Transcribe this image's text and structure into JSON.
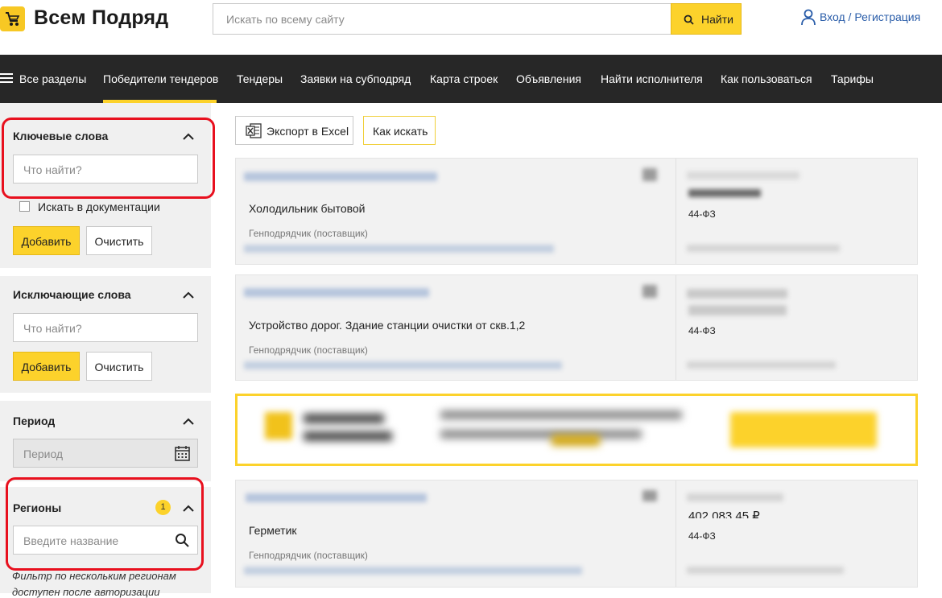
{
  "header": {
    "logo_text": "Всем Подряд",
    "search_placeholder": "Искать по всему сайту",
    "search_button": "Найти",
    "login_link": "Вход / Регистрация"
  },
  "nav": {
    "items": [
      {
        "label": "Все разделы"
      },
      {
        "label": "Победители тендеров"
      },
      {
        "label": "Тендеры"
      },
      {
        "label": "Заявки на субподряд"
      },
      {
        "label": "Карта строек"
      },
      {
        "label": "Объявления"
      },
      {
        "label": "Найти исполнителя"
      },
      {
        "label": "Как пользоваться"
      },
      {
        "label": "Тарифы"
      }
    ],
    "active_index": 1
  },
  "filters": {
    "keywords": {
      "title": "Ключевые слова",
      "placeholder": "Что найти?",
      "checkbox_label": "Искать в документации",
      "add_button": "Добавить",
      "clear_button": "Очистить"
    },
    "exclude": {
      "title": "Исключающие слова",
      "placeholder": "Что найти?",
      "add_button": "Добавить",
      "clear_button": "Очистить"
    },
    "period": {
      "title": "Период",
      "placeholder": "Период"
    },
    "regions": {
      "title": "Регионы",
      "badge": "1",
      "placeholder": "Введите название",
      "note_line1": "Фильтр по нескольким регионам",
      "note_line2": "доступен после авторизации"
    }
  },
  "toolbar": {
    "export_button": "Экспорт в Excel",
    "how_to_button": "Как искать"
  },
  "results": [
    {
      "title": "Холодильник бытовой",
      "role": "Генподрядчик (поставщик)",
      "law": "44-ФЗ"
    },
    {
      "title": "Устройство дорог. Здание станции очистки от скв.1,2",
      "role": "Генподрядчик (поставщик)",
      "law": "44-ФЗ"
    },
    {
      "title": "Герметик",
      "role": "Генподрядчик (поставщик)",
      "law": "44-ФЗ",
      "price_partial": "402 083,45 ₽"
    }
  ],
  "colors": {
    "accent": "#fcd22b",
    "nav_bg": "#272727",
    "highlight": "#e8101e",
    "link": "#2a5da9"
  }
}
